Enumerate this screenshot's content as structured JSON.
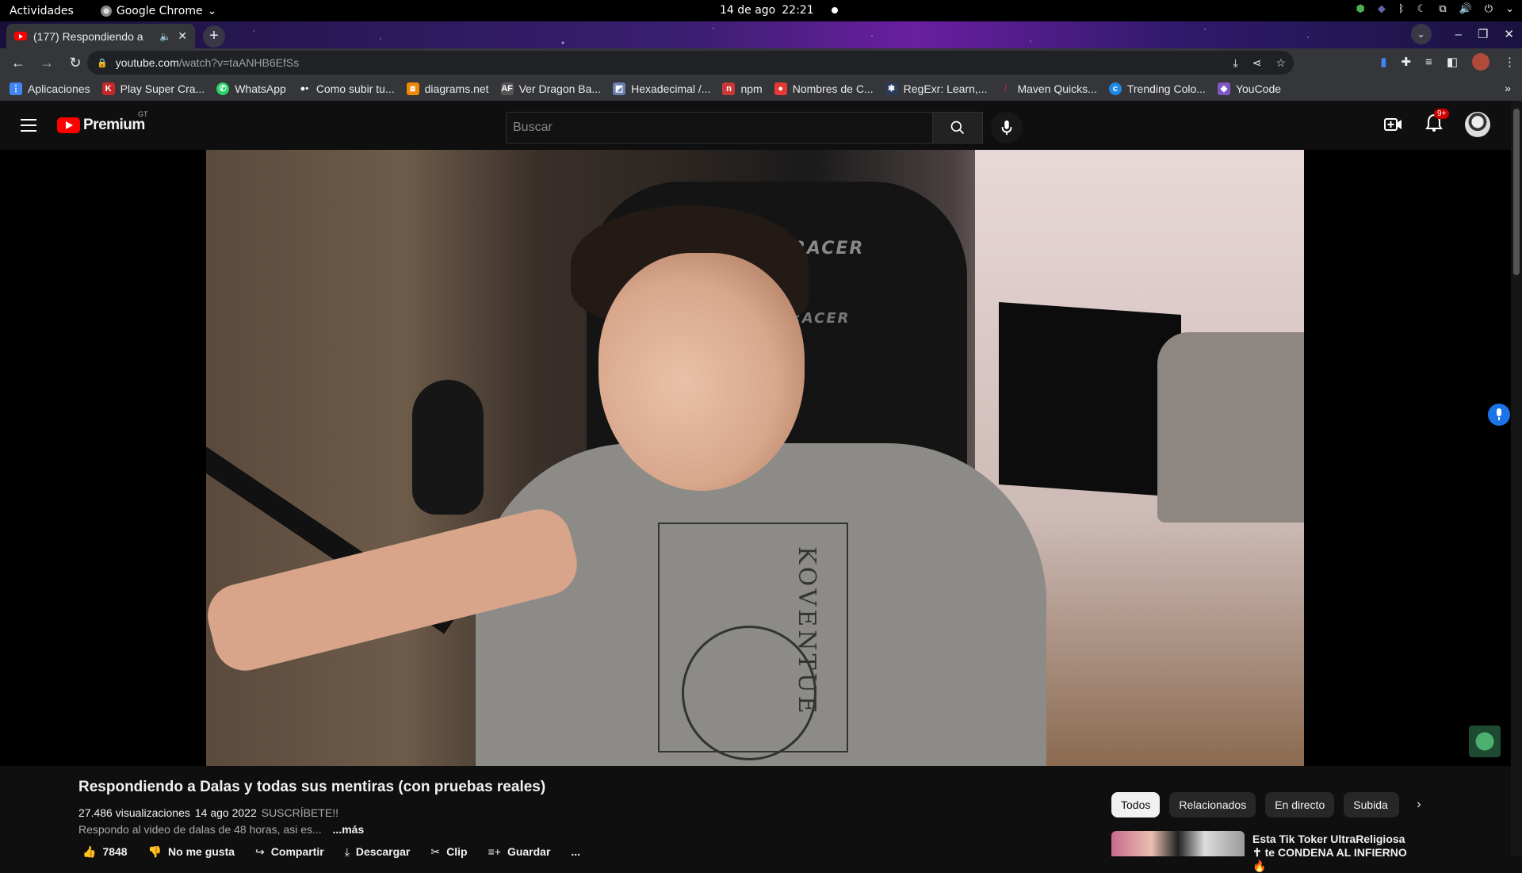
{
  "gnome": {
    "activities": "Actividades",
    "app": "Google Chrome",
    "date": "14 de ago",
    "time": "22:21"
  },
  "browser": {
    "tab_title": "(177) Respondiendo a",
    "url_host": "youtube.com",
    "url_path": "/watch?v=taANHB6EfSs"
  },
  "bookmarks": [
    {
      "label": "Aplicaciones",
      "icon": "apps-grid-icon",
      "color": "#4285f4"
    },
    {
      "label": "Play Super Cra...",
      "icon": "k-icon",
      "color": "#c62828"
    },
    {
      "label": "WhatsApp",
      "icon": "whatsapp-icon",
      "color": "#25d366"
    },
    {
      "label": "Como subir tu...",
      "icon": "medium-icon",
      "color": "#ffffff"
    },
    {
      "label": "diagrams.net",
      "icon": "diagrams-icon",
      "color": "#f08705"
    },
    {
      "label": "Ver Dragon Ba...",
      "icon": "af-icon",
      "color": "#555555"
    },
    {
      "label": "Hexadecimal /...",
      "icon": "hex-icon",
      "color": "#6a7fb0"
    },
    {
      "label": "npm",
      "icon": "npm-icon",
      "color": "#cb3837"
    },
    {
      "label": "Nombres de C...",
      "icon": "nombres-icon",
      "color": "#e53935"
    },
    {
      "label": "RegExr: Learn,...",
      "icon": "regexr-icon",
      "color": "#2a3a5a"
    },
    {
      "label": "Maven Quicks...",
      "icon": "maven-icon",
      "color": "#c2185b"
    },
    {
      "label": "Trending Colo...",
      "icon": "trending-icon",
      "color": "#1e88e5"
    },
    {
      "label": "YouCode",
      "icon": "youcode-icon",
      "color": "#7e57c2"
    }
  ],
  "youtube": {
    "logo_word": "Premium",
    "country": "GT",
    "search_placeholder": "Buscar",
    "notif_count": "9+"
  },
  "video": {
    "chair_brand": "XRACER",
    "shirt_text": "KOVENTUE",
    "title": "Respondiendo a Dalas y todas sus mentiras (con pruebas reales)",
    "views": "27.486 visualizaciones",
    "date": "14 ago 2022",
    "tag": "SUSCRÍBETE!!",
    "description": "Respondo al video de dalas de 48 horas, asi es...",
    "more": "...más"
  },
  "actions": {
    "likes": "7848",
    "dislike": "No me gusta",
    "share": "Compartir",
    "download": "Descargar",
    "clip": "Clip",
    "save": "Guardar",
    "more": "..."
  },
  "chips": [
    "Todos",
    "Relacionados",
    "En directo",
    "Subida"
  ],
  "recommendation": {
    "title": "Esta Tik Toker UltraReligiosa ✝ te CONDENA AL INFIERNO 🔥"
  }
}
